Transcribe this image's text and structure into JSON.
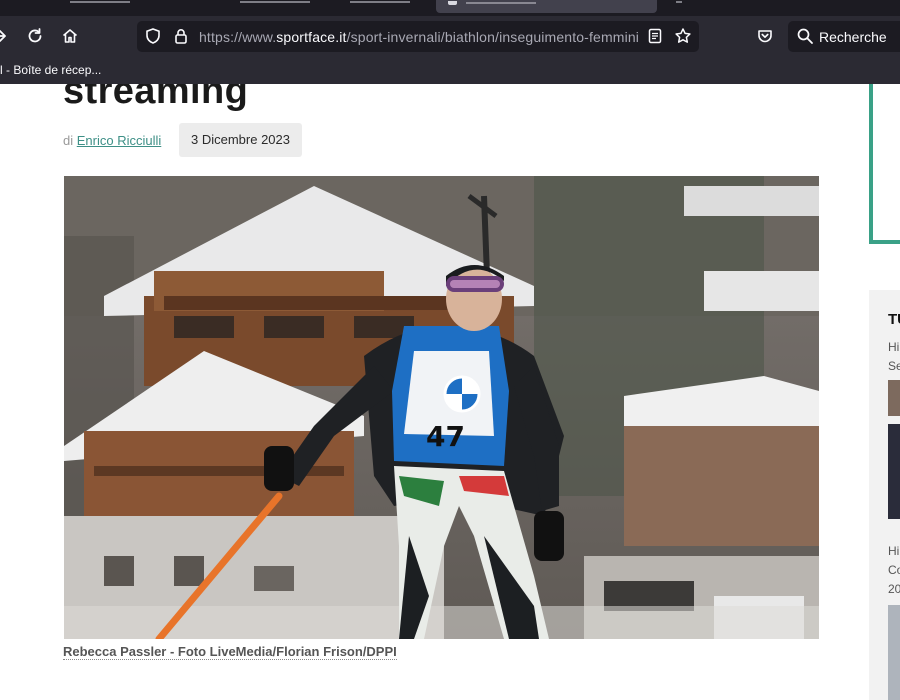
{
  "browser": {
    "url_prefix": "https://www.",
    "url_host": "sportface.it",
    "url_path": "/sport-invernali/biathlon/inseguimento-femminil",
    "search_label": "Recherche",
    "bookmark_label": "l - Boîte de récep..."
  },
  "article": {
    "headline": "streaming",
    "byline_prefix": "di",
    "author": "Enrico Ricciulli",
    "date": "3 Dicembre 2023",
    "caption": "Rebecca Passler - Foto LiveMedia/Florian Frison/DPPI",
    "bib_number": "47"
  },
  "sidebar": {
    "title": "TU",
    "items": [
      {
        "line1": "Hi",
        "line2": "Se"
      },
      {
        "line1": "Hi",
        "line2": "Co",
        "line3": "20"
      }
    ]
  },
  "colors": {
    "accent": "#3aa187",
    "link": "#3d8f86",
    "chrome_dark": "#1c1b22",
    "chrome": "#2b2a33"
  }
}
